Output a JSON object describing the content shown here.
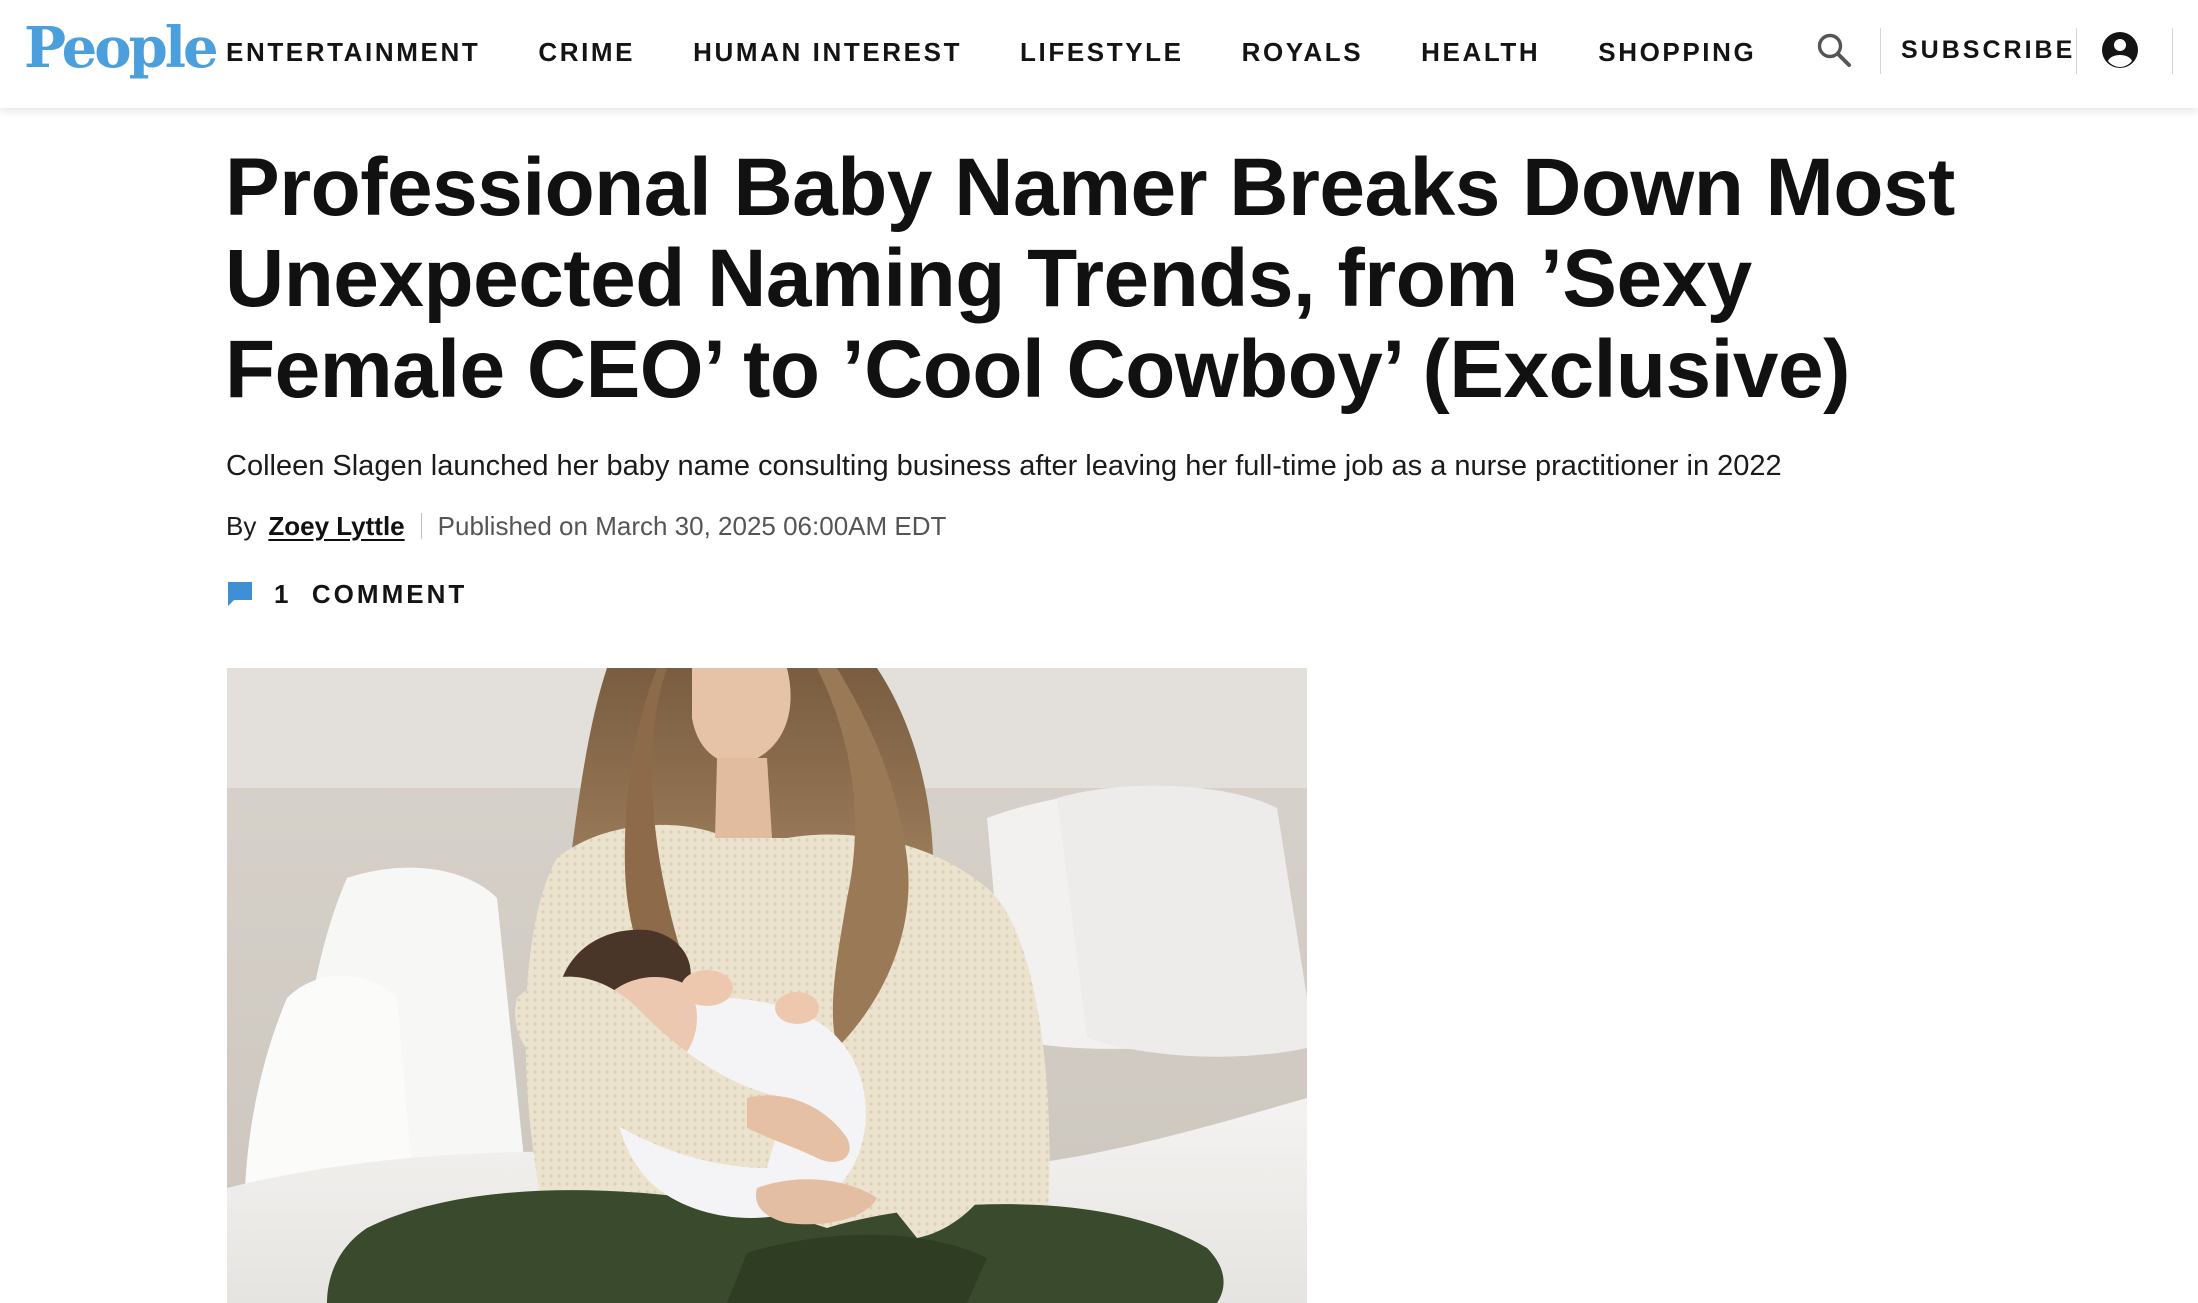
{
  "header": {
    "logo_text": "People",
    "brand_color": "#4b9fdc",
    "nav": [
      {
        "label": "ENTERTAINMENT"
      },
      {
        "label": "CRIME"
      },
      {
        "label": "HUMAN INTEREST"
      },
      {
        "label": "LIFESTYLE"
      },
      {
        "label": "ROYALS"
      },
      {
        "label": "HEALTH"
      },
      {
        "label": "SHOPPING"
      }
    ],
    "search_icon": "search-icon",
    "subscribe_label": "SUBSCRIBE",
    "account_icon": "account-icon"
  },
  "article": {
    "headline": "Professional Baby Namer Breaks Down Most Unexpected Naming Trends, from ’Sexy Female CEO’ to ’Cool Cowboy’ (Exclusive)",
    "dek": "Colleen Slagen launched her baby name consulting business after leaving her full-time job as a nurse practitioner in 2022",
    "byline_prefix": "By",
    "author": "Zoey Lyttle",
    "published": "Published on March 30, 2025 06:00AM EDT",
    "comment_icon": "comment-icon",
    "comment_label": "1  COMMENT",
    "comment_icon_color": "#3f8fd6"
  }
}
